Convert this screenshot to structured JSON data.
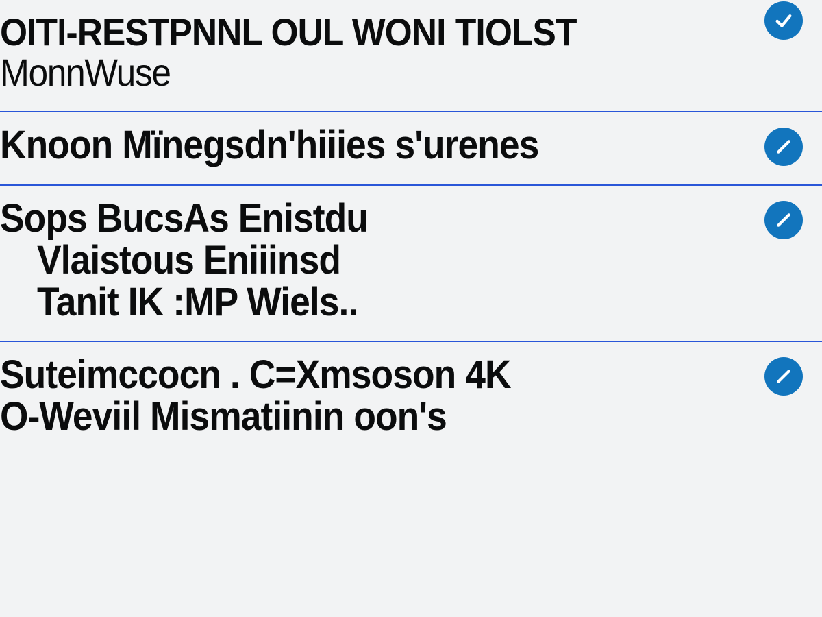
{
  "rows": [
    {
      "title": "OITI-RESTPNNL OUL WONI TIOLST",
      "subtitle": "MonnWuse",
      "status": "done"
    },
    {
      "title": "Knoon Mïnegsdn'hiiies s'urenes",
      "status": "edit"
    },
    {
      "title": "Sops BucsAs Enistdu",
      "sub1": "Vlaistous Eniiinsd",
      "sub2": "Tanit IK :MP Wiels..",
      "status": "edit"
    },
    {
      "title": "Suteimccocn . C=Xmsoson 4K",
      "subtitle": "O-Weviil Mismatiinin oon's",
      "status": "edit"
    }
  ],
  "colors": {
    "accent": "#1275bd",
    "divider": "#2a56d8",
    "bg": "#f2f3f4",
    "text": "#0b0c0d"
  }
}
